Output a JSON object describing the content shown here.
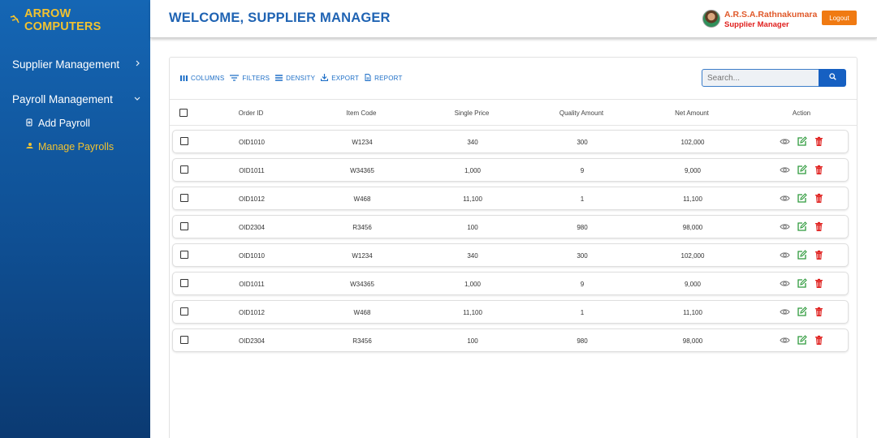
{
  "brand": {
    "name": "ARROW COMPUTERS",
    "icon": "network-icon"
  },
  "sidebar": {
    "groups": [
      {
        "label": "Supplier Management",
        "icon": "chevron-right-icon",
        "expanded": false
      },
      {
        "label": "Payroll Management",
        "icon": "chevron-down-icon",
        "expanded": true
      }
    ],
    "sub_items": [
      {
        "label": "Add Payroll",
        "icon": "add-payroll-icon",
        "active": false
      },
      {
        "label": "Manage Payrolls",
        "icon": "manage-payroll-icon",
        "active": true
      }
    ],
    "colors": {
      "gradient_top": "#1566b4",
      "gradient_bottom": "#0b3a72",
      "accent": "#f2c230"
    }
  },
  "header": {
    "title": "WELCOME, SUPPLIER MANAGER",
    "user_name": "A.R.S.A.Rathnakumara",
    "user_role": "Supplier Manager",
    "logout_label": "Logout",
    "colors": {
      "title": "#1f63b3",
      "logout_bg": "#f07a12"
    }
  },
  "toolbar": {
    "columns_label": "COLUMNS",
    "filters_label": "FILTERS",
    "density_label": "DENSITY",
    "export_label": "EXPORT",
    "report_label": "REPORT"
  },
  "search": {
    "placeholder": "Search...",
    "icon": "search-icon"
  },
  "table": {
    "columns": [
      "Order ID",
      "Item Code",
      "Single Price",
      "Quality Amount",
      "Net Amount",
      "Action"
    ],
    "rows": [
      {
        "order_id": "OID1010",
        "item_code": "W1234",
        "single_price": "340",
        "quality_amount": "300",
        "net_amount": "102,000"
      },
      {
        "order_id": "OID1011",
        "item_code": "W34365",
        "single_price": "1,000",
        "quality_amount": "9",
        "net_amount": "9,000"
      },
      {
        "order_id": "OID1012",
        "item_code": "W468",
        "single_price": "11,100",
        "quality_amount": "1",
        "net_amount": "11,100"
      },
      {
        "order_id": "OID2304",
        "item_code": "R3456",
        "single_price": "100",
        "quality_amount": "980",
        "net_amount": "98,000"
      },
      {
        "order_id": "OID1010",
        "item_code": "W1234",
        "single_price": "340",
        "quality_amount": "300",
        "net_amount": "102,000"
      },
      {
        "order_id": "OID1011",
        "item_code": "W34365",
        "single_price": "1,000",
        "quality_amount": "9",
        "net_amount": "9,000"
      },
      {
        "order_id": "OID1012",
        "item_code": "W468",
        "single_price": "11,100",
        "quality_amount": "1",
        "net_amount": "11,100"
      },
      {
        "order_id": "OID2304",
        "item_code": "R3456",
        "single_price": "100",
        "quality_amount": "980",
        "net_amount": "98,000"
      }
    ],
    "action_icons": [
      "view-icon",
      "edit-icon",
      "delete-icon"
    ],
    "action_colors": {
      "view": "#777777",
      "edit": "#2e9a3c",
      "delete": "#e0201e"
    }
  }
}
